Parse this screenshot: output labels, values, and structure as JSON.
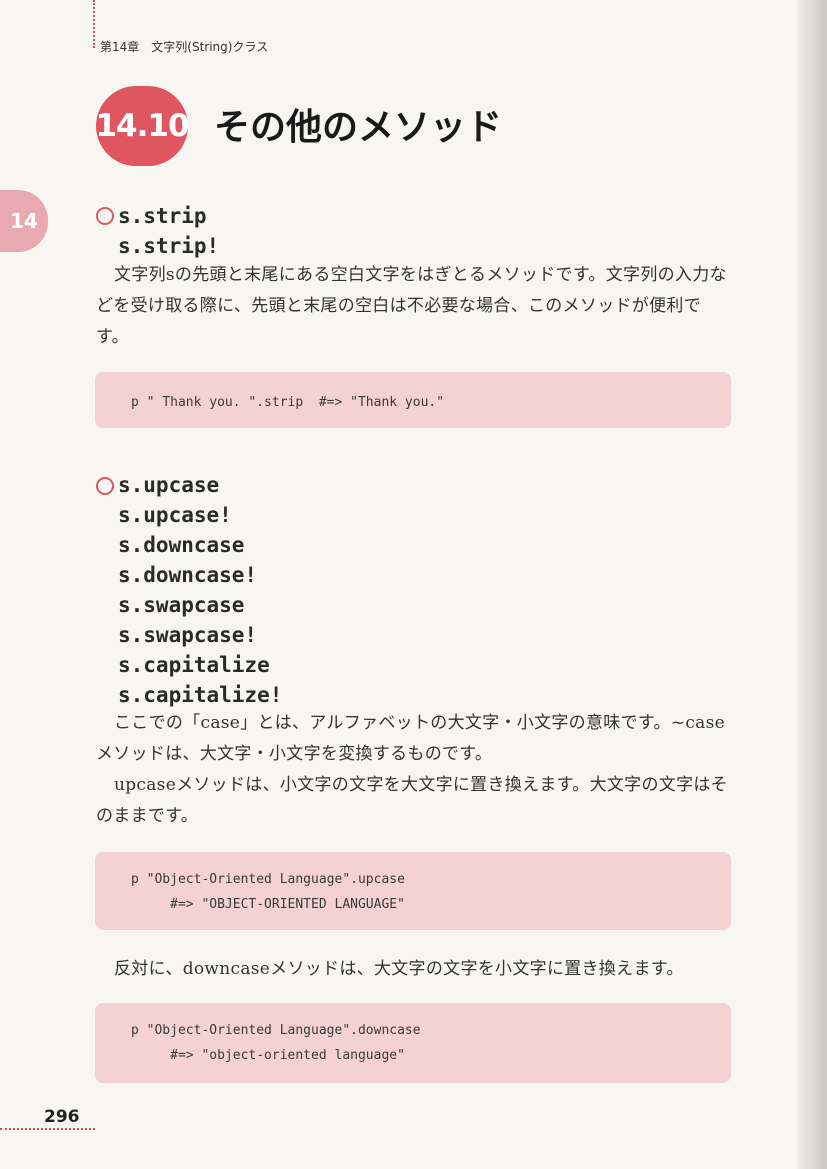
{
  "running_head": "第14章　文字列(String)クラス",
  "side_tab": "14",
  "section": {
    "number": "14.10",
    "title": "その他のメソッド"
  },
  "block1": {
    "methods": [
      "s.strip",
      "s.strip!"
    ],
    "paragraph": "文字列sの先頭と末尾にある空白文字をはぎとるメソッドです。文字列の入力などを受け取る際に、先頭と末尾の空白は不必要な場合、このメソッドが便利です。",
    "code": [
      "p \" Thank you. \".strip  #=> \"Thank you.\""
    ]
  },
  "block2": {
    "methods": [
      "s.upcase",
      "s.upcase!",
      "s.downcase",
      "s.downcase!",
      "s.swapcase",
      "s.swapcase!",
      "s.capitalize",
      "s.capitalize!"
    ],
    "paragraph1": "ここでの「case」とは、アルファベットの大文字・小文字の意味です。~caseメソッドは、大文字・小文字を変換するものです。",
    "paragraph2": "upcaseメソッドは、小文字の文字を大文字に置き換えます。大文字の文字はそのままです。",
    "code_upcase": [
      "p \"Object-Oriented Language\".upcase",
      "     #=> \"OBJECT-ORIENTED LANGUAGE\""
    ],
    "paragraph3": "反対に、downcaseメソッドは、大文字の文字を小文字に置き換えます。",
    "code_downcase": [
      "p \"Object-Oriented Language\".downcase",
      "     #=> \"object-oriented language\""
    ]
  },
  "page_number": "296",
  "colors": {
    "accent": "#e05660",
    "code_bg": "#f4d2d3"
  }
}
